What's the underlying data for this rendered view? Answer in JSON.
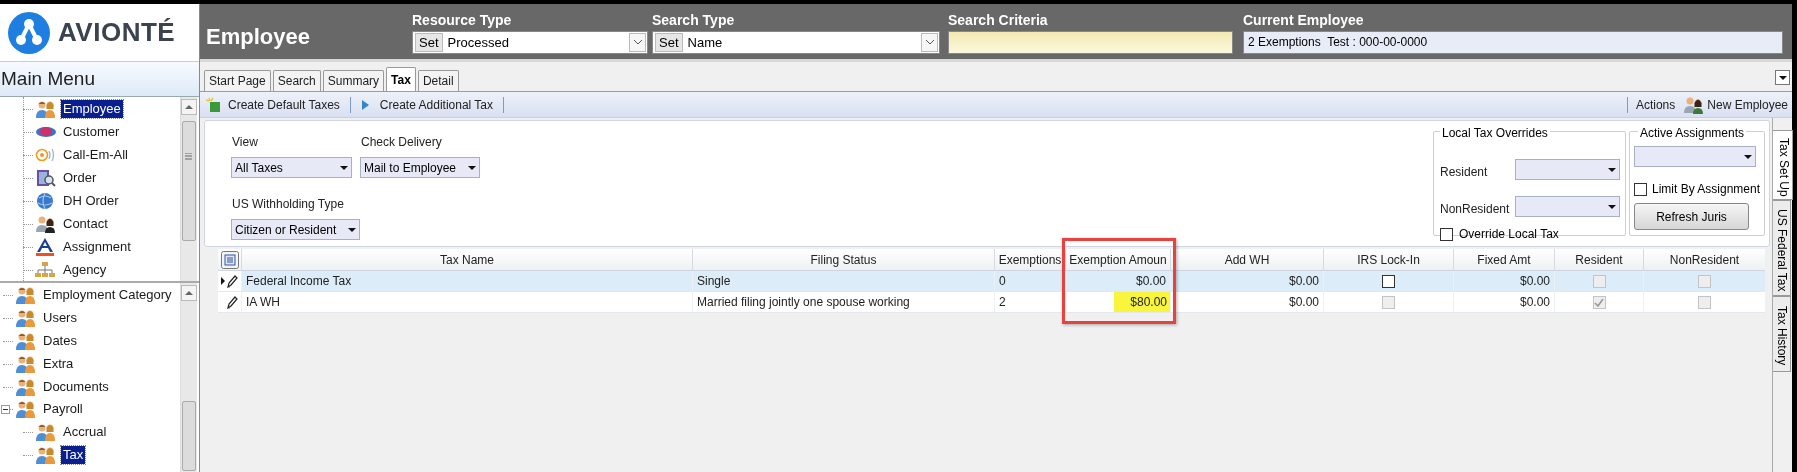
{
  "logo": {
    "text": "AVIONTÉ"
  },
  "header": {
    "title": "Employee",
    "resource_type": {
      "label": "Resource Type",
      "button": "Set",
      "value": "Processed"
    },
    "search_type": {
      "label": "Search Type",
      "button": "Set",
      "value": "Name"
    },
    "search_criteria": {
      "label": "Search Criteria"
    },
    "current_employee": {
      "label": "Current Employee",
      "value": "2 Exemptions  Test : 000-00-0000"
    }
  },
  "main_menu": {
    "title": "Main Menu",
    "upper_items": [
      {
        "label": "Employee",
        "selected": true
      },
      {
        "label": "Customer",
        "selected": false
      },
      {
        "label": "Call-Em-All",
        "selected": false
      },
      {
        "label": "Order",
        "selected": false
      },
      {
        "label": "DH Order",
        "selected": false
      },
      {
        "label": "Contact",
        "selected": false
      },
      {
        "label": "Assignment",
        "selected": false
      },
      {
        "label": "Agency",
        "selected": false
      }
    ],
    "lower_items": [
      {
        "label": "Employment Category",
        "selected": false
      },
      {
        "label": "Users",
        "selected": false
      },
      {
        "label": "Dates",
        "selected": false
      },
      {
        "label": "Extra",
        "selected": false
      },
      {
        "label": "Documents",
        "selected": false
      },
      {
        "label": "Payroll",
        "selected": false,
        "expanded": true,
        "children": [
          {
            "label": "Accrual",
            "selected": false
          },
          {
            "label": "Tax",
            "selected": true
          }
        ]
      }
    ]
  },
  "tabs": [
    {
      "label": "Start Page",
      "selected": false
    },
    {
      "label": "Search",
      "selected": false
    },
    {
      "label": "Summary",
      "selected": false
    },
    {
      "label": "Tax",
      "selected": true
    },
    {
      "label": "Detail",
      "selected": false
    }
  ],
  "toolbar": {
    "left": [
      "Create Default Taxes",
      "Create Additional Tax"
    ],
    "actions": "Actions",
    "new_employee": "New Employee"
  },
  "form": {
    "view": {
      "label": "View",
      "value": "All Taxes"
    },
    "check_delivery": {
      "label": "Check Delivery",
      "value": "Mail to Employee"
    },
    "us_withholding_type": {
      "label": "US Withholding Type",
      "value": "Citizen or Resident"
    },
    "local_tax_overrides": {
      "title": "Local Tax Overrides",
      "resident_label": "Resident",
      "nonresident_label": "NonResident",
      "override": {
        "label": "Override Local Tax",
        "checked": false
      }
    },
    "active_assignments": {
      "title": "Active Assignments",
      "limit": {
        "label": "Limit By Assignment",
        "checked": false
      },
      "refresh_button": "Refresh Juris"
    }
  },
  "side_tabs": [
    {
      "label": "Tax Set Up",
      "selected": true
    },
    {
      "label": "US Federal Tax",
      "selected": false
    },
    {
      "label": "Tax History",
      "selected": false
    }
  ],
  "table": {
    "columns": [
      {
        "label": "Tax Name",
        "annotated": false
      },
      {
        "label": "Filing Status",
        "annotated": false
      },
      {
        "label": "Exemptions",
        "annotated": false
      },
      {
        "label": "Exemption Amoun",
        "annotated": true
      },
      {
        "label": "Add WH",
        "annotated": false
      },
      {
        "label": "IRS Lock-In",
        "annotated": false
      },
      {
        "label": "Fixed Amt",
        "annotated": false
      },
      {
        "label": "Resident",
        "annotated": false
      },
      {
        "label": "NonResident",
        "annotated": false
      }
    ],
    "rows": [
      {
        "selected": true,
        "tax_name": "Federal Income Tax",
        "filing_status": "Single",
        "exemptions": "0",
        "exemption_amount": "$0.00",
        "exemption_amount_highlighted": false,
        "add_wh": "$0.00",
        "irs_lock_in": {
          "checked": false,
          "disabled": false
        },
        "fixed_amt": "$0.00",
        "resident": {
          "checked": false,
          "disabled": true
        },
        "nonresident": {
          "checked": false,
          "disabled": true
        }
      },
      {
        "selected": false,
        "tax_name": "IA WH",
        "filing_status": "Married filing jointly one spouse working",
        "exemptions": "2",
        "exemption_amount": "$80.00",
        "exemption_amount_highlighted": true,
        "add_wh": "$0.00",
        "irs_lock_in": {
          "checked": false,
          "disabled": true
        },
        "fixed_amt": "$0.00",
        "resident": {
          "checked": true,
          "disabled": true
        },
        "nonresident": {
          "checked": false,
          "disabled": true
        }
      }
    ]
  }
}
